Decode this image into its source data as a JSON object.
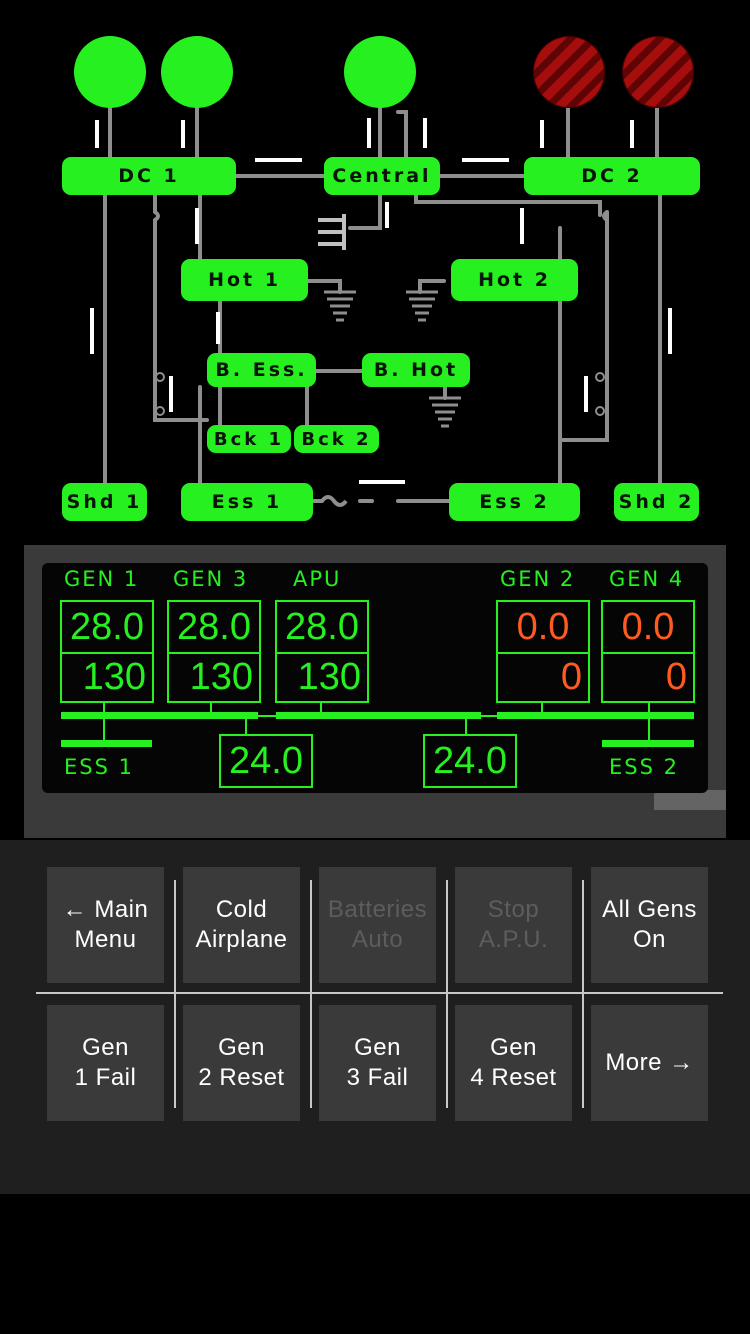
{
  "generators": [
    {
      "name": "gen-1-light",
      "state": "on"
    },
    {
      "name": "gen-3-light",
      "state": "on"
    },
    {
      "name": "apu-light",
      "state": "on"
    },
    {
      "name": "gen-2-light",
      "state": "failed"
    },
    {
      "name": "gen-4-light",
      "state": "failed"
    }
  ],
  "colors": {
    "bus_on": "#27f021",
    "wire": "#8e8e8e",
    "failed_value": "#ff5a1f",
    "button_bg": "#3a3a3a"
  },
  "schematic": {
    "dc1": "DC 1",
    "central": "Central",
    "dc2": "DC 2",
    "hot1": "Hot 1",
    "hot2": "Hot 2",
    "bess": "B. Ess.",
    "bhot": "B. Hot",
    "bck1": "Bck 1",
    "bck2": "Bck 2",
    "shd1": "Shd 1",
    "ess1": "Ess 1",
    "ess2": "Ess 2",
    "shd2": "Shd 2"
  },
  "gauges": {
    "labels": {
      "gen1": "GEN 1",
      "gen3": "GEN 3",
      "apu": "APU",
      "gen2": "GEN 2",
      "gen4": "GEN 4",
      "ess1": "ESS 1",
      "ess2": "ESS 2"
    },
    "gen1": {
      "volts": "28.0",
      "amps": "130"
    },
    "gen3": {
      "volts": "28.0",
      "amps": "130"
    },
    "apu": {
      "volts": "28.0",
      "amps": "130"
    },
    "gen2": {
      "volts": "0.0",
      "amps": "0"
    },
    "gen4": {
      "volts": "0.0",
      "amps": "0"
    },
    "ess1_volts": "24.0",
    "ess2_volts": "24.0"
  },
  "buttons": [
    {
      "label": "← Main\nMenu",
      "enabled": true
    },
    {
      "label": "Cold\nAirplane",
      "enabled": true
    },
    {
      "label": "Batteries\nAuto",
      "enabled": false
    },
    {
      "label": "Stop\nA.P.U.",
      "enabled": false
    },
    {
      "label": "All Gens\nOn",
      "enabled": true
    },
    {
      "label": "Gen\n1 Fail",
      "enabled": true
    },
    {
      "label": "Gen\n2 Reset",
      "enabled": true
    },
    {
      "label": "Gen\n3 Fail",
      "enabled": true
    },
    {
      "label": "Gen\n4 Reset",
      "enabled": true
    },
    {
      "label": "More →",
      "enabled": true
    }
  ]
}
